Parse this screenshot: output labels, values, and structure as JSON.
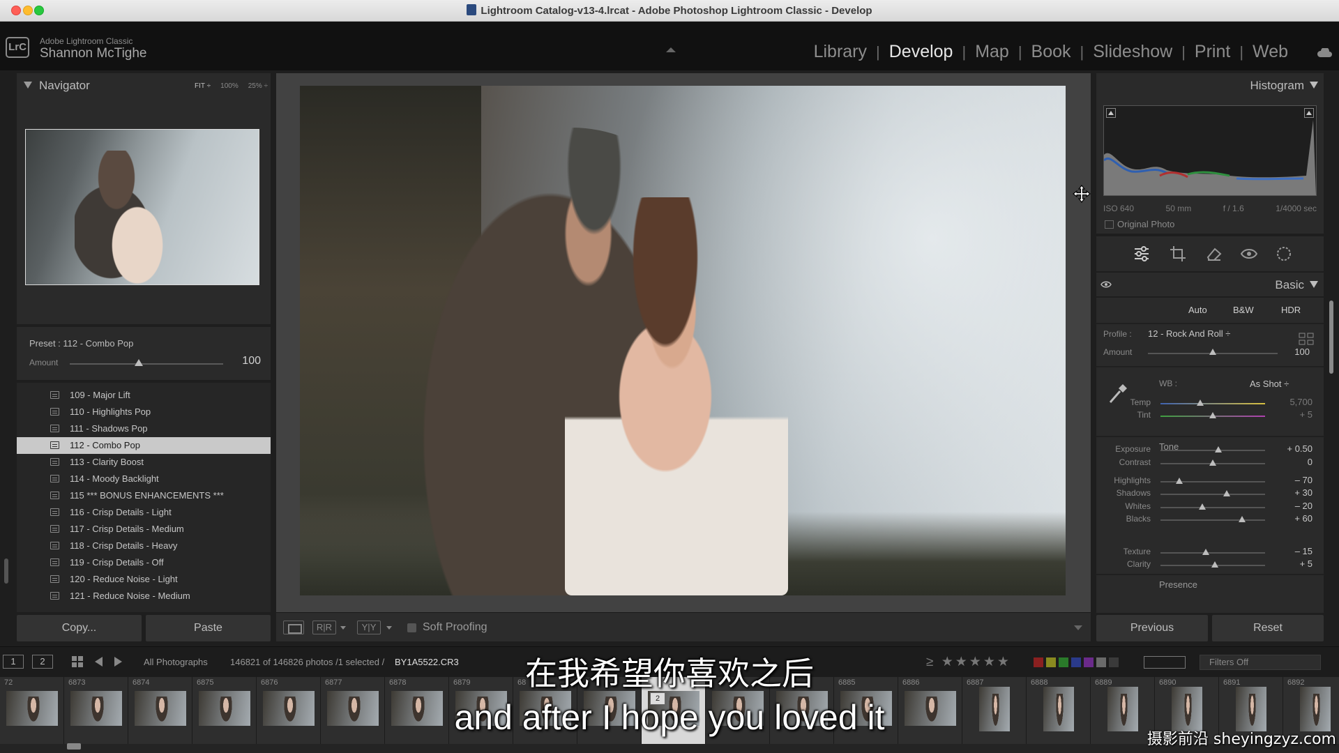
{
  "window": {
    "title": "Lightroom Catalog-v13-4.lrcat - Adobe Photoshop Lightroom Classic - Develop"
  },
  "identity": {
    "logo": "LrC",
    "app_name": "Adobe Lightroom Classic",
    "user_name": "Shannon McTighe"
  },
  "modules": {
    "library": "Library",
    "develop": "Develop",
    "map": "Map",
    "book": "Book",
    "slideshow": "Slideshow",
    "print": "Print",
    "web": "Web",
    "active": "Develop"
  },
  "navigator": {
    "title": "Navigator",
    "zoom_fit": "FIT ÷",
    "zoom_100": "100%",
    "zoom_25": "25% ÷",
    "preset_label": "Preset : 112 - Combo Pop",
    "amount_label": "Amount",
    "amount_value": "100",
    "amount_level": 0.45
  },
  "presets": {
    "items": [
      {
        "label": "109 - Major Lift"
      },
      {
        "label": "110 - Highlights Pop"
      },
      {
        "label": "111 - Shadows Pop"
      },
      {
        "label": "112 - Combo Pop",
        "selected": true
      },
      {
        "label": "113 - Clarity Boost"
      },
      {
        "label": "114 - Moody Backlight"
      },
      {
        "label": "115 *** BONUS ENHANCEMENTS ***"
      },
      {
        "label": "116 - Crisp Details - Light"
      },
      {
        "label": "117 - Crisp Details - Medium"
      },
      {
        "label": "118 - Crisp Details - Heavy"
      },
      {
        "label": "119 - Crisp Details - Off"
      },
      {
        "label": "120 - Reduce Noise - Light"
      },
      {
        "label": "121 - Reduce Noise - Medium"
      }
    ],
    "copy_label": "Copy...",
    "paste_label": "Paste"
  },
  "toolbar": {
    "soft_proofing": "Soft Proofing",
    "ba_label": "R|R",
    "yy_label": "Y|Y"
  },
  "histogram": {
    "title": "Histogram",
    "iso": "ISO 640",
    "focal": "50 mm",
    "aperture": "f / 1.6",
    "shutter": "1/4000 sec",
    "original_photo": "Original Photo"
  },
  "basic": {
    "title": "Basic",
    "treatment": {
      "auto": "Auto",
      "bw": "B&W",
      "hdr": "HDR"
    },
    "profile_label": "Profile :",
    "profile_value": "12 - Rock And Roll ÷",
    "profile_amount_label": "Amount",
    "profile_amount_value": "100",
    "profile_amount_level": 0.5,
    "wb_label": "WB :",
    "wb_value": "As Shot ÷",
    "tone_label": "Tone",
    "presence_label": "Presence",
    "sliders": [
      {
        "key": "temp",
        "label": "Temp",
        "value": "5,700",
        "level": 0.38
      },
      {
        "key": "tint",
        "label": "Tint",
        "value": "+ 5",
        "level": 0.5
      },
      {
        "key": "exposure",
        "label": "Exposure",
        "value": "+ 0.50",
        "level": 0.55
      },
      {
        "key": "contrast",
        "label": "Contrast",
        "value": "0",
        "level": 0.5
      },
      {
        "key": "highlights",
        "label": "Highlights",
        "value": "– 70",
        "level": 0.18
      },
      {
        "key": "shadows",
        "label": "Shadows",
        "value": "+ 30",
        "level": 0.63
      },
      {
        "key": "whites",
        "label": "Whites",
        "value": "– 20",
        "level": 0.4
      },
      {
        "key": "blacks",
        "label": "Blacks",
        "value": "+ 60",
        "level": 0.78
      },
      {
        "key": "texture",
        "label": "Texture",
        "value": "– 15",
        "level": 0.43
      },
      {
        "key": "clarity",
        "label": "Clarity",
        "value": "+ 5",
        "level": 0.52
      }
    ],
    "previous_label": "Previous",
    "reset_label": "Reset"
  },
  "filmstrip": {
    "page_one": "1",
    "page_two": "2",
    "source": "All Photographs",
    "count": "146821 of 146826 photos /1 selected /",
    "file": "BY1A5522.CR3",
    "filter": "Filters Off",
    "compare_symbol": "≥",
    "stars": "★★★★★",
    "color_labels": [
      "#8a2020",
      "#8a8a20",
      "#2a7a2a",
      "#2a3a8a",
      "#6a2a8a",
      "#6a6a6a",
      "#3a3a3a"
    ],
    "selected_badge": "2",
    "cells": [
      {
        "num": "72"
      },
      {
        "num": "6873"
      },
      {
        "num": "6874"
      },
      {
        "num": "6875"
      },
      {
        "num": "6876"
      },
      {
        "num": "6877"
      },
      {
        "num": "6878"
      },
      {
        "num": "6879"
      },
      {
        "num": "68"
      },
      {
        "num": ""
      },
      {
        "num": "",
        "selected": true
      },
      {
        "num": ""
      },
      {
        "num": ""
      },
      {
        "num": "6885"
      },
      {
        "num": "6886"
      },
      {
        "num": "6887",
        "vertical": true
      },
      {
        "num": "6888",
        "vertical": true
      },
      {
        "num": "6889",
        "vertical": true
      },
      {
        "num": "6890",
        "vertical": true
      },
      {
        "num": "6891",
        "vertical": true
      },
      {
        "num": "6892",
        "vertical": true
      }
    ]
  },
  "subtitles": {
    "cn": "在我希望你喜欢之后",
    "en": "and after I hope you loved it"
  },
  "watermark": "摄影前沿 sheyingzyz.com"
}
